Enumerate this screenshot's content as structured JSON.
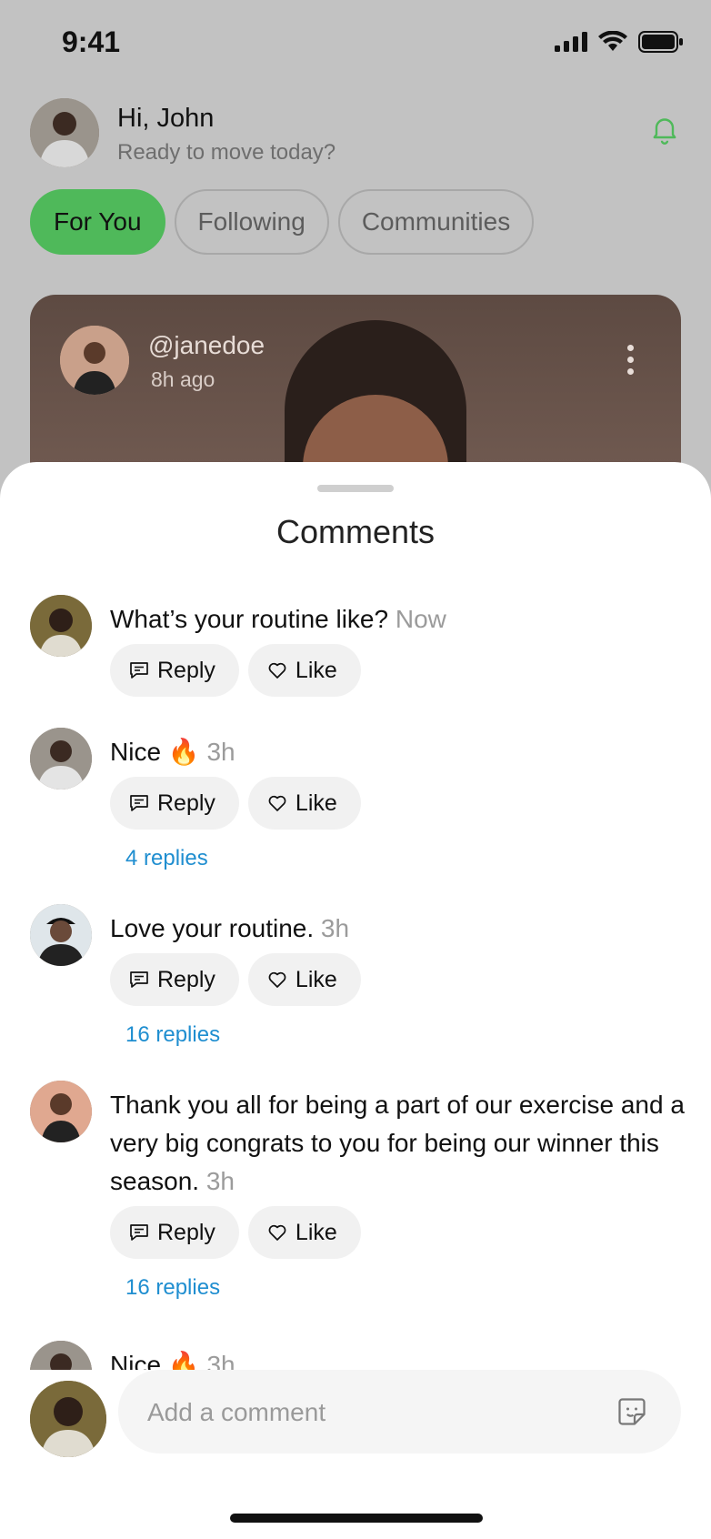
{
  "status": {
    "time": "9:41"
  },
  "header": {
    "greeting": "Hi, John",
    "subtitle": "Ready to move today?"
  },
  "tabs": [
    {
      "label": "For You",
      "active": true
    },
    {
      "label": "Following",
      "active": false
    },
    {
      "label": "Communities",
      "active": false
    }
  ],
  "post": {
    "handle": "@janedoe",
    "time": "8h ago"
  },
  "comments_sheet": {
    "title": "Comments",
    "reply_label": "Reply",
    "like_label": "Like",
    "items": [
      {
        "text": "What’s your routine like?",
        "time": "Now",
        "replies": ""
      },
      {
        "text": "Nice 🔥",
        "time": "3h",
        "replies": "4 replies"
      },
      {
        "text": "Love your routine.",
        "time": "3h",
        "replies": "16 replies"
      },
      {
        "text": "Thank you all for being a part of our exercise and a very big congrats to you for being our winner this season.",
        "time": "3h",
        "replies": "16 replies"
      },
      {
        "text": "Nice 🔥",
        "time": "3h",
        "replies": ""
      }
    ]
  },
  "composer": {
    "placeholder": "Add a comment"
  },
  "colors": {
    "accent": "#4fb95a",
    "link": "#1f8ed0"
  }
}
